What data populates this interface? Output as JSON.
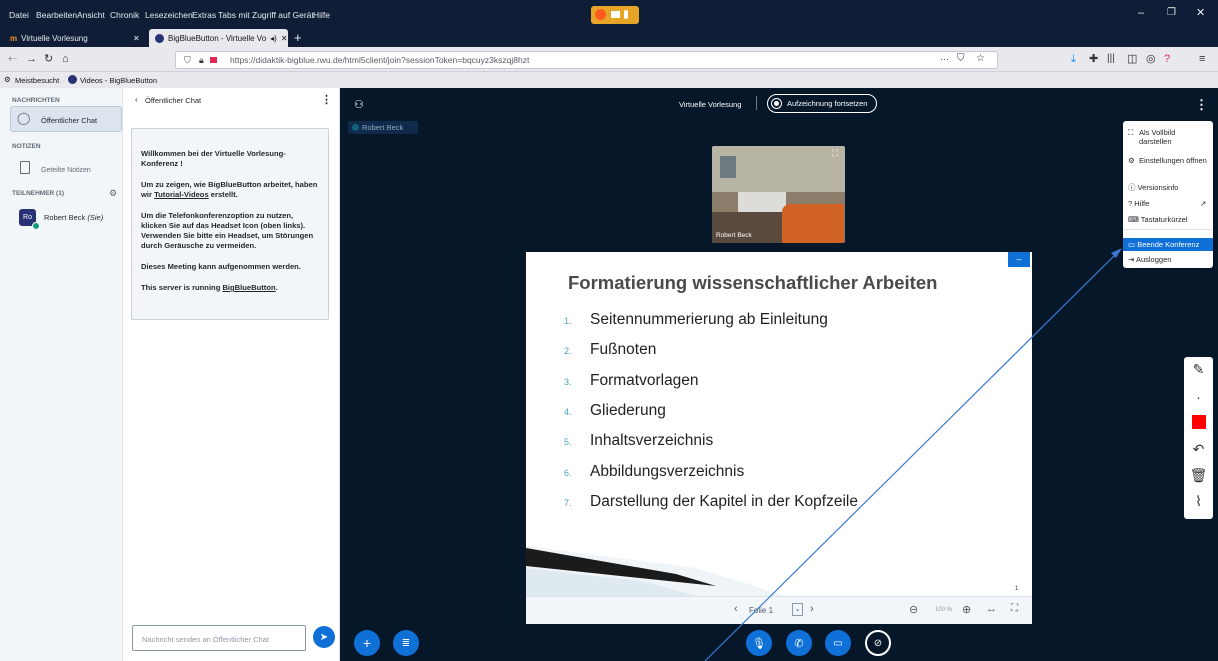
{
  "menubar": {
    "items": [
      "Datei",
      "Bearbeiten",
      "Ansicht",
      "Chronik",
      "Lesezeichen",
      "Extras",
      "Tabs mit Zugriff auf Gerät",
      "Hilfe"
    ]
  },
  "tabs": [
    {
      "label": "Virtuelle Vorlesung"
    },
    {
      "label": "BigBlueButton - Virtuelle Vo"
    }
  ],
  "url": {
    "text": "https://didaktik-bigblue.rwu.de/html5client/join?sessionToken=bqcuyz3kszqj8hzt"
  },
  "bookmarks": {
    "items": [
      "Meistbesucht",
      "Videos - BigBlueButton"
    ]
  },
  "userlist": {
    "messages_header": "NACHRICHTEN",
    "public_chat": "Öffentlicher Chat",
    "notes_header": "NOTIZEN",
    "shared_notes": "Geteilte Notizen",
    "participants_header": "TEILNEHMER (1)",
    "user_initials": "Ro",
    "user_name": "Robert Beck",
    "user_suffix": "(Sie)"
  },
  "chat": {
    "header": "Öffentlicher Chat",
    "welcome_1a": "Willkommen bei der ",
    "welcome_1b": "Virtuelle Vorlesung",
    "welcome_1c": "-Konferenz !",
    "welcome_2a": "Um zu zeigen, wie BigBlueButton arbeitet, haben wir ",
    "welcome_2b": "Tutorial-Videos",
    "welcome_2c": " erstellt.",
    "welcome_3a": "Um die Telefonkonferenzoption zu nutzen, klicken Sie auf das Headset Icon (oben links). ",
    "welcome_3b": "Verwenden Sie bitte ein Headset, um Störungen durch Geräusche zu vermeiden.",
    "welcome_4": "Dieses Meeting kann aufgenommen werden.",
    "welcome_5a": "This server is running ",
    "welcome_5b": "BigBlueButton",
    "welcome_5c": ".",
    "input_placeholder": "Nachricht senden an Öffentlicher Chat"
  },
  "main": {
    "meeting_title": "Virtuelle Vorlesung",
    "recording_label": "Aufzeichnung fortsetzen",
    "talker": "Robert Beck",
    "video_name": "Robert Beck"
  },
  "slide": {
    "title": "Formatierung wissenschaftlicher Arbeiten",
    "items": [
      {
        "n": "1.",
        "t": "Seitennummerierung ab Einleitung"
      },
      {
        "n": "2.",
        "t": "Fußnoten"
      },
      {
        "n": "3.",
        "t": "Formatvorlagen"
      },
      {
        "n": "4.",
        "t": "Gliederung"
      },
      {
        "n": "5.",
        "t": "Inhaltsverzeichnis"
      },
      {
        "n": "6.",
        "t": "Abbildungsverzeichnis"
      },
      {
        "n": "7.",
        "t": "Darstellung der Kapitel in der Kopfzeile"
      }
    ],
    "page_number": "1",
    "slide_label": "Folie 1",
    "zoom": "100 %"
  },
  "options_menu": {
    "fullscreen": "Als Vollbild darstellen",
    "settings": "Einstellungen öffnen",
    "version": "Versionsinfo",
    "help": "Hilfe",
    "shortcuts": "Tastaturkürzel",
    "end_meeting": "Beende Konferenz",
    "logout": "Ausloggen"
  },
  "colors": {
    "accent": "#0f70d7",
    "main_bg": "#06172a",
    "firefox_dark": "#0f1e36"
  }
}
